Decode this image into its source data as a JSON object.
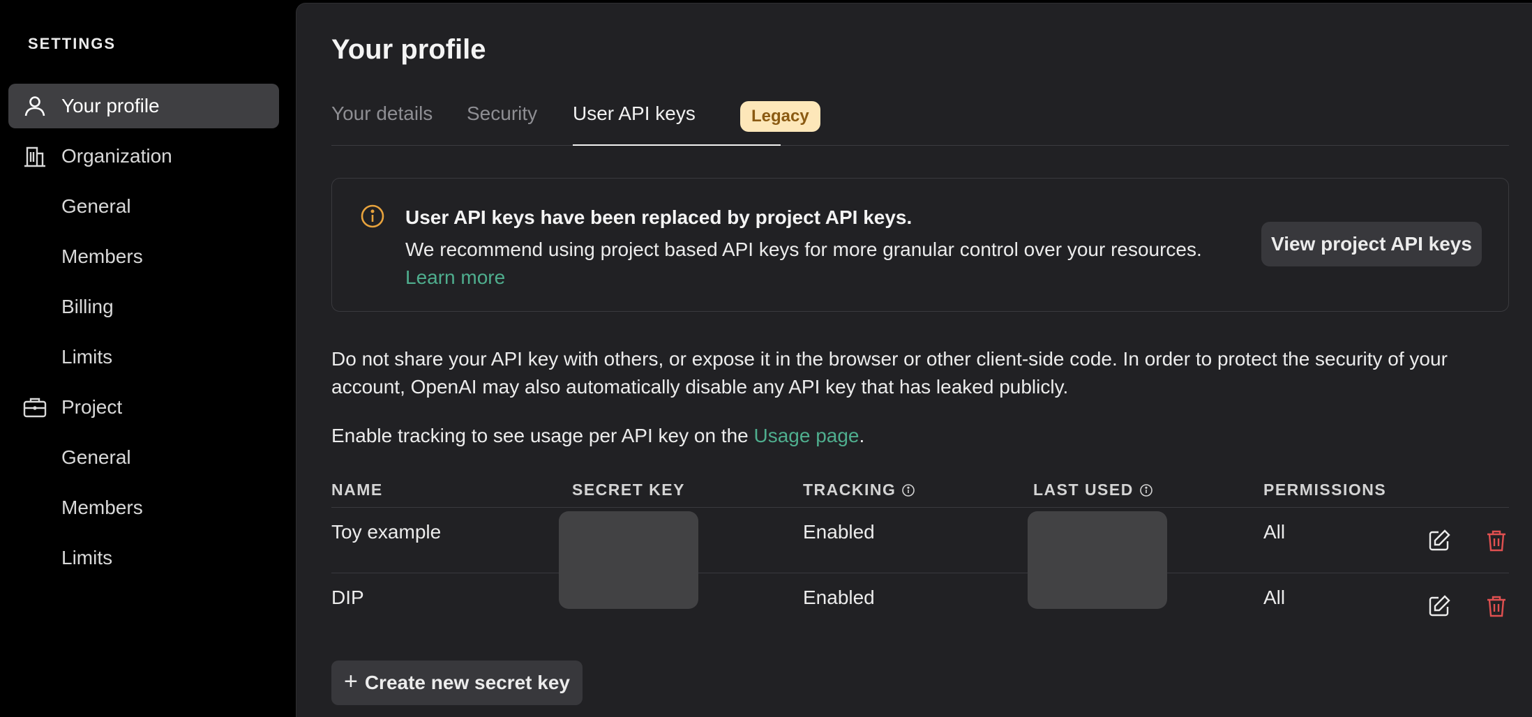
{
  "sidebar": {
    "heading": "SETTINGS",
    "items": [
      {
        "label": "Your profile",
        "icon": "user-icon",
        "active": true
      },
      {
        "label": "Organization",
        "icon": "building-icon"
      },
      {
        "label": "General"
      },
      {
        "label": "Members"
      },
      {
        "label": "Billing"
      },
      {
        "label": "Limits"
      },
      {
        "label": "Project",
        "icon": "briefcase-icon"
      },
      {
        "label": "General"
      },
      {
        "label": "Members"
      },
      {
        "label": "Limits"
      }
    ]
  },
  "page": {
    "title": "Your profile",
    "tabs": [
      {
        "label": "Your details"
      },
      {
        "label": "Security"
      },
      {
        "label": "User API keys",
        "active": true
      }
    ],
    "badge": "Legacy"
  },
  "notice": {
    "icon": "info-circle-icon",
    "title": "User API keys have been replaced by project API keys.",
    "body": "We recommend using project based API keys for more granular control over your resources.",
    "link": "Learn more",
    "button": "View project API keys"
  },
  "warning_text": "Do not share your API key with others, or expose it in the browser or other client-side code. In order to protect the security of your account, OpenAI may also automatically disable any API key that has leaked publicly.",
  "tracking_text": {
    "prefix": "Enable tracking to see usage per API key on the ",
    "link": "Usage page",
    "suffix": "."
  },
  "table": {
    "headers": [
      "NAME",
      "SECRET KEY",
      "TRACKING",
      "LAST USED",
      "PERMISSIONS"
    ],
    "rows": [
      {
        "name": "Toy example",
        "tracking": "Enabled",
        "permissions": "All"
      },
      {
        "name": "DIP",
        "tracking": "Enabled",
        "permissions": "All"
      }
    ]
  },
  "create_button": {
    "plus": "+",
    "label": "Create new secret key"
  },
  "colors": {
    "accent_link": "#4fae8e",
    "badge_bg": "#fde7b9",
    "badge_text": "#8a5a12",
    "info_icon": "#e8a33d",
    "delete_icon": "#e05050"
  }
}
